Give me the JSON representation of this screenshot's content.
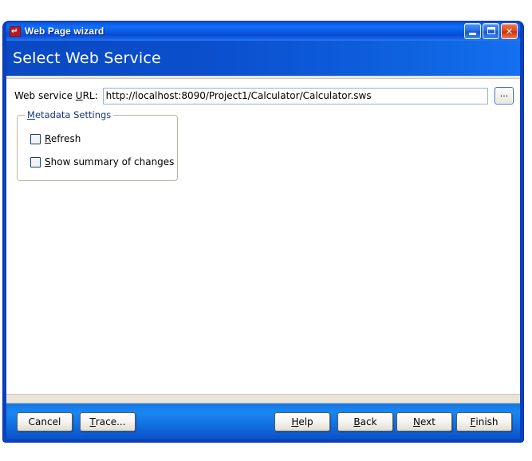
{
  "window": {
    "title": "Web Page wizard",
    "icon": "wizard-red-arrow-icon",
    "controls": {
      "minimize": "Minimize",
      "maximize": "Maximize",
      "close": "Close",
      "close_glyph": "✕"
    }
  },
  "banner": {
    "title": "Select Web Service"
  },
  "form": {
    "url_label_pre": "Web service ",
    "url_label_acc": "U",
    "url_label_post": "RL:",
    "url_value": "http://localhost:8090/Project1/Calculator/Calculator.sws",
    "url_placeholder": "",
    "browse_label": "...",
    "group": {
      "legend_acc": "M",
      "legend_rest": "etadata Settings",
      "checkboxes": [
        {
          "acc": "R",
          "rest": "efresh",
          "checked": false
        },
        {
          "acc": "S",
          "rest": "how summary of changes",
          "checked": false
        }
      ]
    }
  },
  "footer": {
    "buttons": [
      {
        "name": "cancel",
        "acc": "",
        "pre": "Cancel",
        "post": ""
      },
      {
        "name": "trace",
        "pre": "",
        "acc": "T",
        "post": "race..."
      },
      {
        "name": "help",
        "pre": "",
        "acc": "H",
        "post": "elp"
      },
      {
        "name": "back",
        "pre": "",
        "acc": "B",
        "post": "ack"
      },
      {
        "name": "next",
        "pre": "",
        "acc": "N",
        "post": "ext"
      },
      {
        "name": "finish",
        "pre": "",
        "acc": "F",
        "post": "inish"
      }
    ]
  },
  "colors": {
    "titlebar_blue": "#0f6ff5",
    "banner_blue": "#0b4fcd",
    "footer_blue": "#1478e8",
    "legend_text": "#13387f",
    "content_bg": "#ffffff",
    "strip_beige": "#e9e5da",
    "close_red": "#c5300c"
  }
}
